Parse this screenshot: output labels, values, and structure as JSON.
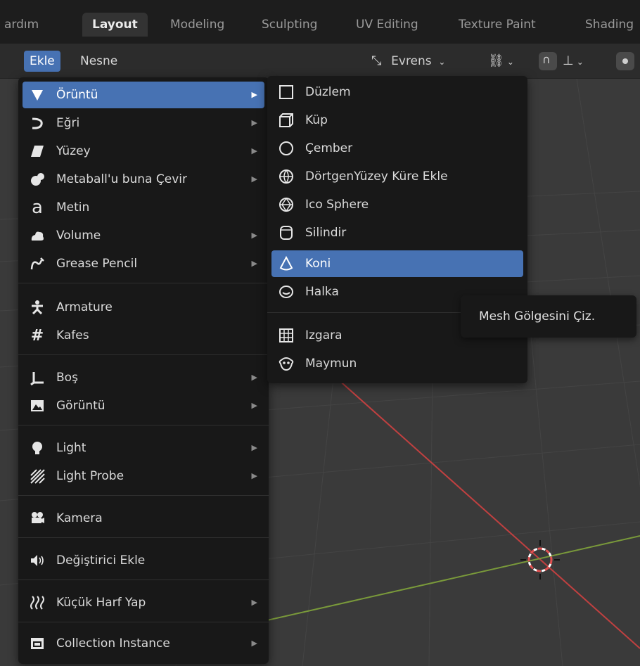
{
  "workspace_tabs": [
    {
      "label": "ardım"
    },
    {
      "label": "Layout"
    },
    {
      "label": "Modeling"
    },
    {
      "label": "Sculpting"
    },
    {
      "label": "UV Editing"
    },
    {
      "label": "Texture Paint"
    },
    {
      "label": "Shading"
    }
  ],
  "header": {
    "add_menu": "Ekle",
    "object_menu": "Nesne",
    "transform_orientation": "Evrens"
  },
  "add_menu": {
    "items": [
      {
        "label": "Örüntü",
        "icon": "mesh-icon",
        "submenu": true,
        "highlighted": true
      },
      {
        "label": "Eğri",
        "icon": "curve-icon",
        "submenu": true
      },
      {
        "label": "Yüzey",
        "icon": "surface-icon",
        "submenu": true
      },
      {
        "label": "Metaball'u buna Çevir",
        "icon": "metaball-icon",
        "submenu": true
      },
      {
        "label": "Metin",
        "icon": "text-icon",
        "submenu": false
      },
      {
        "label": "Volume",
        "icon": "volume-icon",
        "submenu": true
      },
      {
        "label": "Grease Pencil",
        "icon": "grease-pencil-icon",
        "submenu": true
      },
      {
        "label": "Armature",
        "icon": "armature-icon",
        "submenu": false
      },
      {
        "label": "Kafes",
        "icon": "lattice-icon",
        "submenu": false
      },
      {
        "label": "Boş",
        "icon": "empty-icon",
        "submenu": true
      },
      {
        "label": "Görüntü",
        "icon": "image-icon",
        "submenu": true
      },
      {
        "label": "Light",
        "icon": "light-icon",
        "submenu": true
      },
      {
        "label": "Light Probe",
        "icon": "light-probe-icon",
        "submenu": true
      },
      {
        "label": "Kamera",
        "icon": "camera-icon",
        "submenu": false
      },
      {
        "label": "Değiştirici Ekle",
        "icon": "speaker-icon",
        "submenu": false
      },
      {
        "label": "Küçük Harf Yap",
        "icon": "force-field-icon",
        "submenu": true
      },
      {
        "label": "Collection Instance",
        "icon": "collection-icon",
        "submenu": true
      }
    ]
  },
  "mesh_submenu": {
    "items": [
      {
        "label": "Düzlem",
        "icon": "plane-icon"
      },
      {
        "label": "Küp",
        "icon": "cube-icon"
      },
      {
        "label": "Çember",
        "icon": "circle-icon"
      },
      {
        "label": "DörtgenYüzey Küre Ekle",
        "icon": "uv-sphere-icon"
      },
      {
        "label": "Ico Sphere",
        "icon": "ico-sphere-icon"
      },
      {
        "label": "Silindir",
        "icon": "cylinder-icon"
      },
      {
        "label": "Koni",
        "icon": "cone-icon",
        "highlighted": true
      },
      {
        "label": "Halka",
        "icon": "torus-icon"
      },
      {
        "label": "Izgara",
        "icon": "grid-icon"
      },
      {
        "label": "Maymun",
        "icon": "monkey-icon"
      }
    ]
  },
  "tooltip": {
    "text": "Mesh Gölgesini Çiz."
  },
  "colors": {
    "highlight": "#4772b3",
    "menu_bg": "#181818",
    "viewport_bg": "#3a3a3a",
    "x_axis": "#c04040",
    "y_axis": "#7a9a3a"
  }
}
